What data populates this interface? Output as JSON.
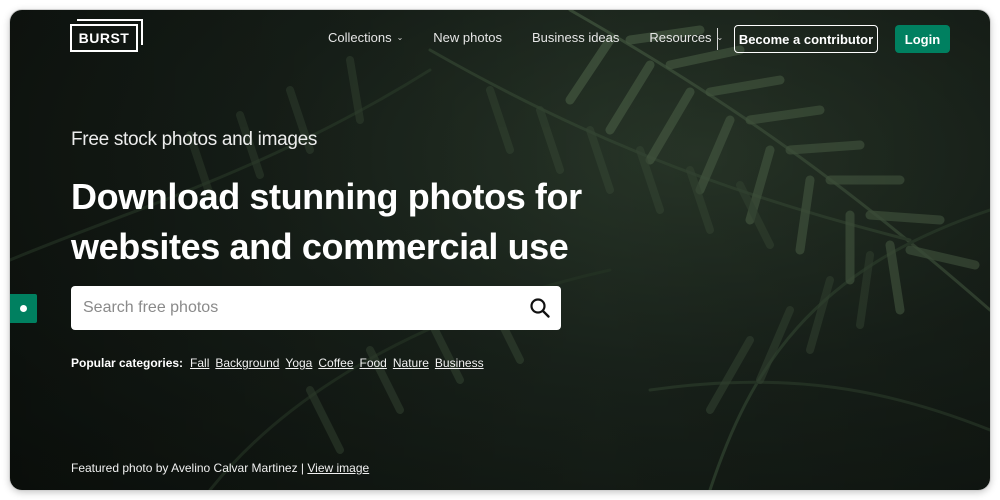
{
  "brand": {
    "logo_text": "BURST",
    "accent_color": "#008060"
  },
  "nav": {
    "items": [
      {
        "label": "Collections",
        "has_dropdown": true
      },
      {
        "label": "New photos",
        "has_dropdown": false
      },
      {
        "label": "Business ideas",
        "has_dropdown": false
      },
      {
        "label": "Resources",
        "has_dropdown": true
      }
    ],
    "contributor_button": "Become a contributor",
    "login_button": "Login"
  },
  "hero": {
    "subtitle": "Free stock photos and images",
    "headline": "Download stunning photos for websites and commercial use",
    "search_placeholder": "Search free photos",
    "search_icon": "search-icon"
  },
  "categories": {
    "label": "Popular categories:",
    "items": [
      "Fall",
      "Background",
      "Yoga",
      "Coffee",
      "Food",
      "Nature",
      "Business"
    ]
  },
  "credit": {
    "text": "Featured photo by Avelino Calvar Martinez |",
    "link": "View image"
  }
}
